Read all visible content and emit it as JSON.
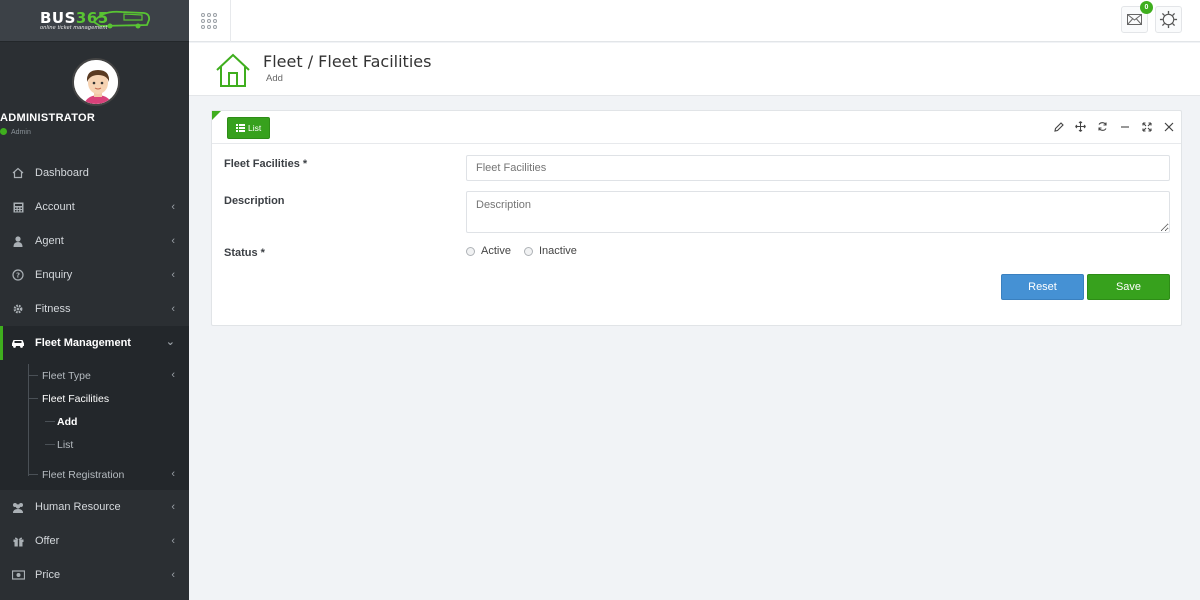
{
  "logo": {
    "text_main": "BUS",
    "text_num": "365",
    "tagline": "online ticket management"
  },
  "user": {
    "name": "ADMINISTRATOR",
    "role": "Admin"
  },
  "nav": {
    "items": [
      {
        "label": "Dashboard",
        "icon": "home-icon"
      },
      {
        "label": "Account",
        "icon": "calculator-icon"
      },
      {
        "label": "Agent",
        "icon": "user-icon"
      },
      {
        "label": "Enquiry",
        "icon": "question-icon"
      },
      {
        "label": "Fitness",
        "icon": "gear-icon"
      },
      {
        "label": "Fleet Management",
        "icon": "car-icon"
      },
      {
        "label": "Human Resource",
        "icon": "users-icon"
      },
      {
        "label": "Offer",
        "icon": "gift-icon"
      },
      {
        "label": "Price",
        "icon": "money-icon"
      }
    ],
    "fleet_sub": {
      "fleet_type": "Fleet Type",
      "fleet_facilities": "Fleet Facilities",
      "add": "Add",
      "list": "List",
      "fleet_registration": "Fleet Registration"
    }
  },
  "topbar": {
    "messages_count": "0"
  },
  "header": {
    "title": "Fleet / Fleet Facilities",
    "subtitle": "Add"
  },
  "panel": {
    "list_button": "List",
    "form": {
      "facilities_label": "Fleet Facilities *",
      "facilities_placeholder": "Fleet Facilities",
      "description_label": "Description",
      "description_placeholder": "Description",
      "status_label": "Status *",
      "status_options": [
        "Active",
        "Inactive"
      ],
      "reset_label": "Reset",
      "save_label": "Save"
    }
  },
  "colors": {
    "accent_green": "#3fae1e",
    "reset_blue": "#4591d4",
    "sidebar_bg": "#2b2f33"
  }
}
